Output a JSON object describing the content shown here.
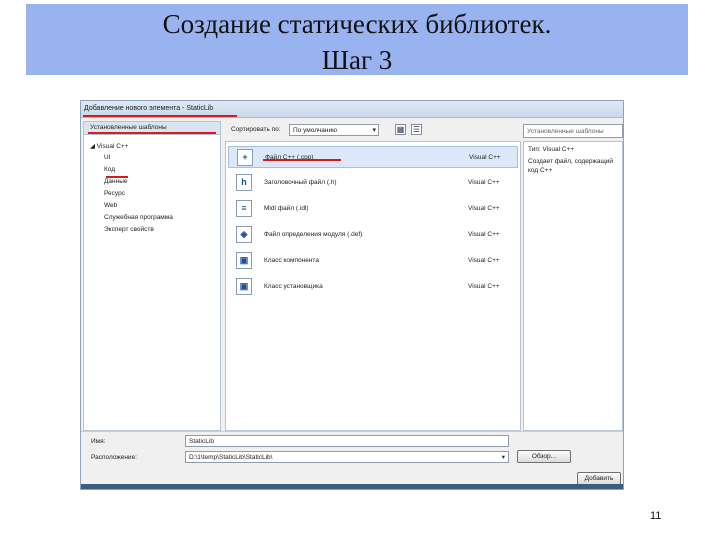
{
  "slide": {
    "title_line1": "Создание статических библиотек.",
    "title_line2": "Шаг 3",
    "page_number": "11"
  },
  "dialog": {
    "title": "Добавление нового элемента - StaticLib",
    "installed_templates_header": "Установленные шаблоны",
    "tree": [
      {
        "label": "◢ Visual C++",
        "selected": false
      },
      {
        "label": "UI",
        "selected": false
      },
      {
        "label": "Код",
        "selected": true
      },
      {
        "label": "Данные",
        "selected": false
      },
      {
        "label": "Ресурс",
        "selected": false
      },
      {
        "label": "Web",
        "selected": false
      },
      {
        "label": "Служебная программа",
        "selected": false
      },
      {
        "label": "Эксперт свойств",
        "selected": false
      }
    ],
    "sort_label": "Сортировать по:",
    "sort_value": "По умолчанию",
    "search_placeholder": "Установленные шаблоны",
    "items": [
      {
        "name": "Файл C++ (.cpp)",
        "lang": "Visual C++",
        "icon": "cpp-file-icon",
        "glyph": "+"
      },
      {
        "name": "Заголовочный файл (.h)",
        "lang": "Visual C++",
        "icon": "header-file-icon",
        "glyph": "h"
      },
      {
        "name": "Midl файл (.idl)",
        "lang": "Visual C++",
        "icon": "idl-file-icon",
        "glyph": "≡"
      },
      {
        "name": "Файл определения модуля (.def)",
        "lang": "Visual C++",
        "icon": "def-file-icon",
        "glyph": "◈"
      },
      {
        "name": "Класс компонента",
        "lang": "Visual C++",
        "icon": "component-class-icon",
        "glyph": "▣"
      },
      {
        "name": "Класс установщика",
        "lang": "Visual C++",
        "icon": "installer-class-icon",
        "glyph": "▣"
      }
    ],
    "details": {
      "type_line": "Тип: Visual C++",
      "desc_line1": "Создает файл, содержащий",
      "desc_line2": "код C++"
    },
    "name_label": "Имя:",
    "name_value": "StaticLib",
    "location_label": "Расположение:",
    "location_value": "D:\\1\\temp\\StaticLib\\StaticLib\\",
    "browse_label": "Обзор...",
    "add_label": "Добавить"
  },
  "colors": {
    "title_band": "#99b3f0",
    "highlight_red": "#d51c1c"
  }
}
